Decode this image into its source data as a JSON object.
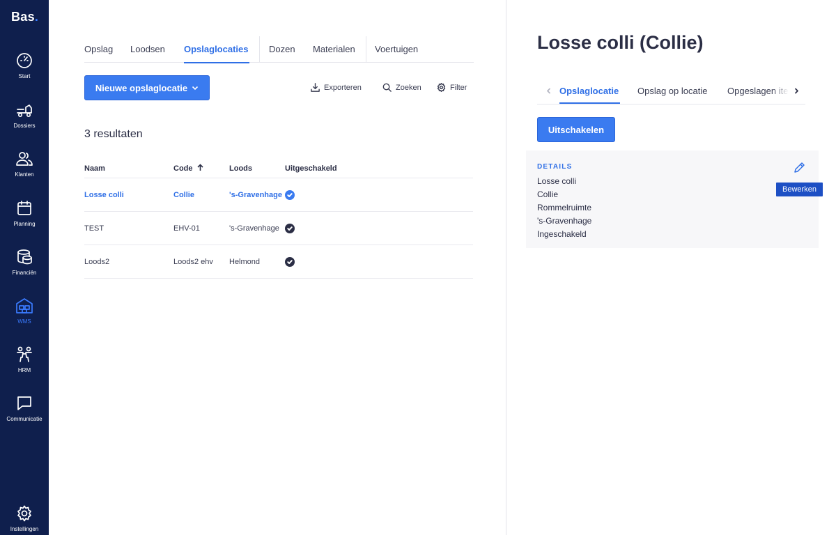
{
  "app": {
    "logo_text": "Bas",
    "logo_dot": "."
  },
  "sidebar": {
    "items": [
      {
        "label": "Start",
        "icon": "speedometer-icon"
      },
      {
        "label": "Dossiers",
        "icon": "truck-icon"
      },
      {
        "label": "Klanten",
        "icon": "users-icon"
      },
      {
        "label": "Planning",
        "icon": "calendar-icon"
      },
      {
        "label": "Financiën",
        "icon": "coins-icon"
      },
      {
        "label": "WMS",
        "icon": "warehouse-icon"
      },
      {
        "label": "HRM",
        "icon": "people-icon"
      },
      {
        "label": "Communicatie",
        "icon": "chat-icon"
      }
    ],
    "active": "WMS",
    "settings_label": "Instellingen"
  },
  "main": {
    "tabs": [
      {
        "label": "Opslag"
      },
      {
        "label": "Loodsen"
      },
      {
        "label": "Opslaglocaties",
        "active": true
      },
      {
        "label": "Dozen"
      },
      {
        "label": "Materialen"
      },
      {
        "label": "Voertuigen"
      }
    ],
    "new_button_label": "Nieuwe opslaglocatie",
    "toolbar": {
      "export_label": "Exporteren",
      "search_label": "Zoeken",
      "filter_label": "Filter"
    },
    "results_text": "3 resultaten",
    "table": {
      "headers": {
        "name": "Naam",
        "code": "Code",
        "loods": "Loods",
        "disabled": "Uitgeschakeld"
      },
      "rows": [
        {
          "name": "Losse colli",
          "code": "Collie",
          "loods": "'s-Gravenhage",
          "highlight": true
        },
        {
          "name": "TEST",
          "code": "EHV-01",
          "loods": "'s-Gravenhage",
          "highlight": false
        },
        {
          "name": "Loods2",
          "code": "Loods2 ehv",
          "loods": "Helmond",
          "highlight": false
        }
      ]
    }
  },
  "detail": {
    "title": "Losse colli (Collie)",
    "tabs": [
      {
        "label": "Opslaglocatie",
        "active": true
      },
      {
        "label": "Opslag op locatie"
      },
      {
        "label": "Opgeslagen items"
      }
    ],
    "disable_button_label": "Uitschakelen",
    "details_heading": "DETAILS",
    "details_values": [
      "Losse colli",
      "Collie",
      "Rommelruimte",
      "'s-Gravenhage",
      "Ingeschakeld"
    ],
    "edit_tooltip": "Bewerken"
  },
  "colors": {
    "sidebar_bg": "#0f1f4d",
    "accent": "#3a7bf0",
    "link": "#2f6fe6",
    "tooltip_bg": "#1d4fc4"
  }
}
